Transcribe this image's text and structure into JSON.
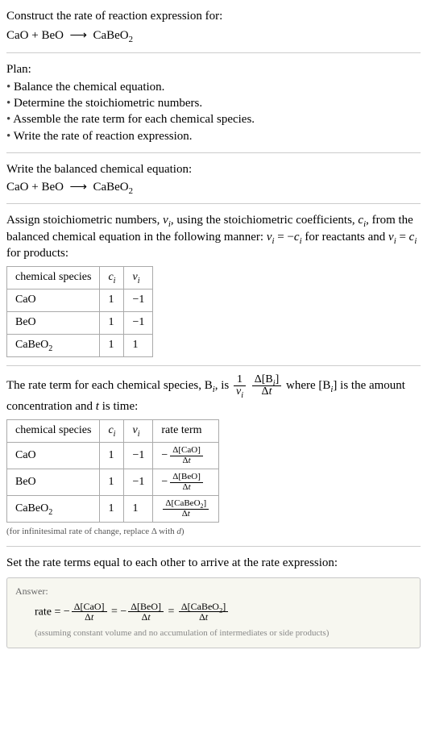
{
  "prompt": {
    "line1": "Construct the rate of reaction expression for:",
    "equation_html": "CaO + BeO &nbsp;⟶&nbsp; CaBeO<sub>2</sub>"
  },
  "plan": {
    "title": "Plan:",
    "items": [
      "Balance the chemical equation.",
      "Determine the stoichiometric numbers.",
      "Assemble the rate term for each chemical species.",
      "Write the rate of reaction expression."
    ]
  },
  "balanced": {
    "intro": "Write the balanced chemical equation:",
    "equation_html": "CaO + BeO &nbsp;⟶&nbsp; CaBeO<sub>2</sub>"
  },
  "stoich": {
    "intro_html": "Assign stoichiometric numbers, <span class='ital'>ν<sub>i</sub></span>, using the stoichiometric coefficients, <span class='ital'>c<sub>i</sub></span>, from the balanced chemical equation in the following manner: <span class='ital'>ν<sub>i</sub></span> = −<span class='ital'>c<sub>i</sub></span> for reactants and <span class='ital'>ν<sub>i</sub></span> = <span class='ital'>c<sub>i</sub></span> for products:",
    "headers": {
      "species": "chemical species",
      "ci_html": "<span class='ci'>c<sub>i</sub></span>",
      "vi_html": "<span class='ci'>ν<sub>i</sub></span>"
    },
    "rows": [
      {
        "species_html": "CaO",
        "ci": "1",
        "vi": "−1"
      },
      {
        "species_html": "BeO",
        "ci": "1",
        "vi": "−1"
      },
      {
        "species_html": "CaBeO<sub>2</sub>",
        "ci": "1",
        "vi": "1"
      }
    ]
  },
  "rateterm": {
    "intro_pre_html": "The rate term for each chemical species, B<sub><i>i</i></sub>, is ",
    "intro_frac1_num_html": "1",
    "intro_frac1_den_html": "<i>ν<sub>i</sub></i>",
    "intro_frac2_num_html": "Δ[B<sub><i>i</i></sub>]",
    "intro_frac2_den_html": "Δ<i>t</i>",
    "intro_post_html": " where [B<sub><i>i</i></sub>] is the amount concentration and <i>t</i> is time:",
    "headers": {
      "species": "chemical species",
      "ci_html": "<span class='ci'>c<sub>i</sub></span>",
      "vi_html": "<span class='ci'>ν<sub>i</sub></span>",
      "rate": "rate term"
    },
    "rows": [
      {
        "species_html": "CaO",
        "ci": "1",
        "vi": "−1",
        "rate_num_html": "Δ[CaO]",
        "rate_den_html": "Δ<i>t</i>",
        "neg": true
      },
      {
        "species_html": "BeO",
        "ci": "1",
        "vi": "−1",
        "rate_num_html": "Δ[BeO]",
        "rate_den_html": "Δ<i>t</i>",
        "neg": true
      },
      {
        "species_html": "CaBeO<sub>2</sub>",
        "ci": "1",
        "vi": "1",
        "rate_num_html": "Δ[CaBeO<sub>2</sub>]",
        "rate_den_html": "Δ<i>t</i>",
        "neg": false
      }
    ],
    "footnote_html": "(for infinitesimal rate of change, replace Δ with <i>d</i>)"
  },
  "final": {
    "intro": "Set the rate terms equal to each other to arrive at the rate expression:",
    "answer_label": "Answer:",
    "answer_prefix": "rate = ",
    "terms": [
      {
        "neg": true,
        "num_html": "Δ[CaO]",
        "den_html": "Δ<i>t</i>"
      },
      {
        "neg": true,
        "num_html": "Δ[BeO]",
        "den_html": "Δ<i>t</i>"
      },
      {
        "neg": false,
        "num_html": "Δ[CaBeO<sub>2</sub>]",
        "den_html": "Δ<i>t</i>"
      }
    ],
    "assumption": "(assuming constant volume and no accumulation of intermediates or side products)"
  },
  "chart_data": {
    "type": "table",
    "tables": [
      {
        "title": "stoichiometric numbers",
        "columns": [
          "chemical species",
          "c_i",
          "ν_i"
        ],
        "rows": [
          [
            "CaO",
            1,
            -1
          ],
          [
            "BeO",
            1,
            -1
          ],
          [
            "CaBeO2",
            1,
            1
          ]
        ]
      },
      {
        "title": "rate terms",
        "columns": [
          "chemical species",
          "c_i",
          "ν_i",
          "rate term"
        ],
        "rows": [
          [
            "CaO",
            1,
            -1,
            "-Δ[CaO]/Δt"
          ],
          [
            "BeO",
            1,
            -1,
            "-Δ[BeO]/Δt"
          ],
          [
            "CaBeO2",
            1,
            1,
            "Δ[CaBeO2]/Δt"
          ]
        ]
      }
    ]
  }
}
